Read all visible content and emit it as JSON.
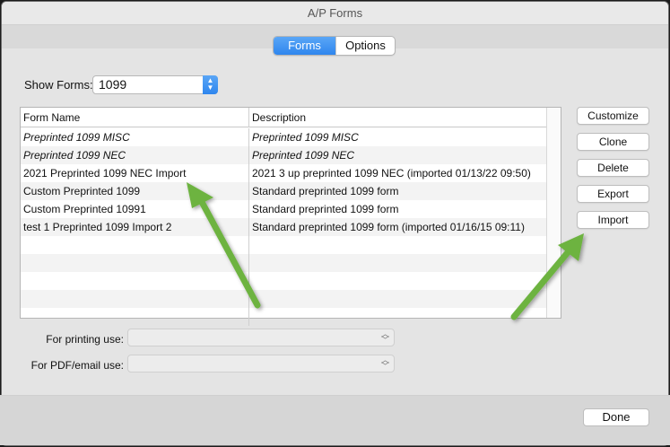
{
  "window": {
    "title": "A/P Forms"
  },
  "tabs": [
    {
      "label": "Forms",
      "active": true
    },
    {
      "label": "Options",
      "active": false
    }
  ],
  "show_forms": {
    "label": "Show Forms:",
    "value": "1099"
  },
  "table": {
    "columns": [
      "Form Name",
      "Description"
    ],
    "rows": [
      {
        "name": "Preprinted 1099 MISC",
        "description": "Preprinted 1099 MISC",
        "italic": true
      },
      {
        "name": "Preprinted 1099 NEC",
        "description": "Preprinted 1099 NEC",
        "italic": true
      },
      {
        "name": "2021 Preprinted 1099 NEC Import",
        "description": "2021 3 up preprinted 1099 NEC (imported 01/13/22 09:50)",
        "italic": false
      },
      {
        "name": "Custom Preprinted 1099",
        "description": "Standard preprinted 1099 form",
        "italic": false
      },
      {
        "name": "Custom Preprinted 10991",
        "description": "Standard preprinted 1099 form",
        "italic": false
      },
      {
        "name": "test  1 Preprinted 1099 Import 2",
        "description": "Standard preprinted 1099 form (imported 01/16/15 09:11)",
        "italic": false
      }
    ]
  },
  "actions": {
    "customize": "Customize",
    "clone": "Clone",
    "delete": "Delete",
    "export": "Export",
    "import": "Import"
  },
  "printing_use": {
    "label": "For printing use:",
    "value": ""
  },
  "pdf_use": {
    "label": "For PDF/email use:",
    "value": ""
  },
  "done_label": "Done",
  "colors": {
    "accent": "#3b8ff2",
    "arrow": "#6db33f"
  },
  "icons": {
    "stepper": "up-down-chevron-icon",
    "annotation": "green-arrow"
  }
}
